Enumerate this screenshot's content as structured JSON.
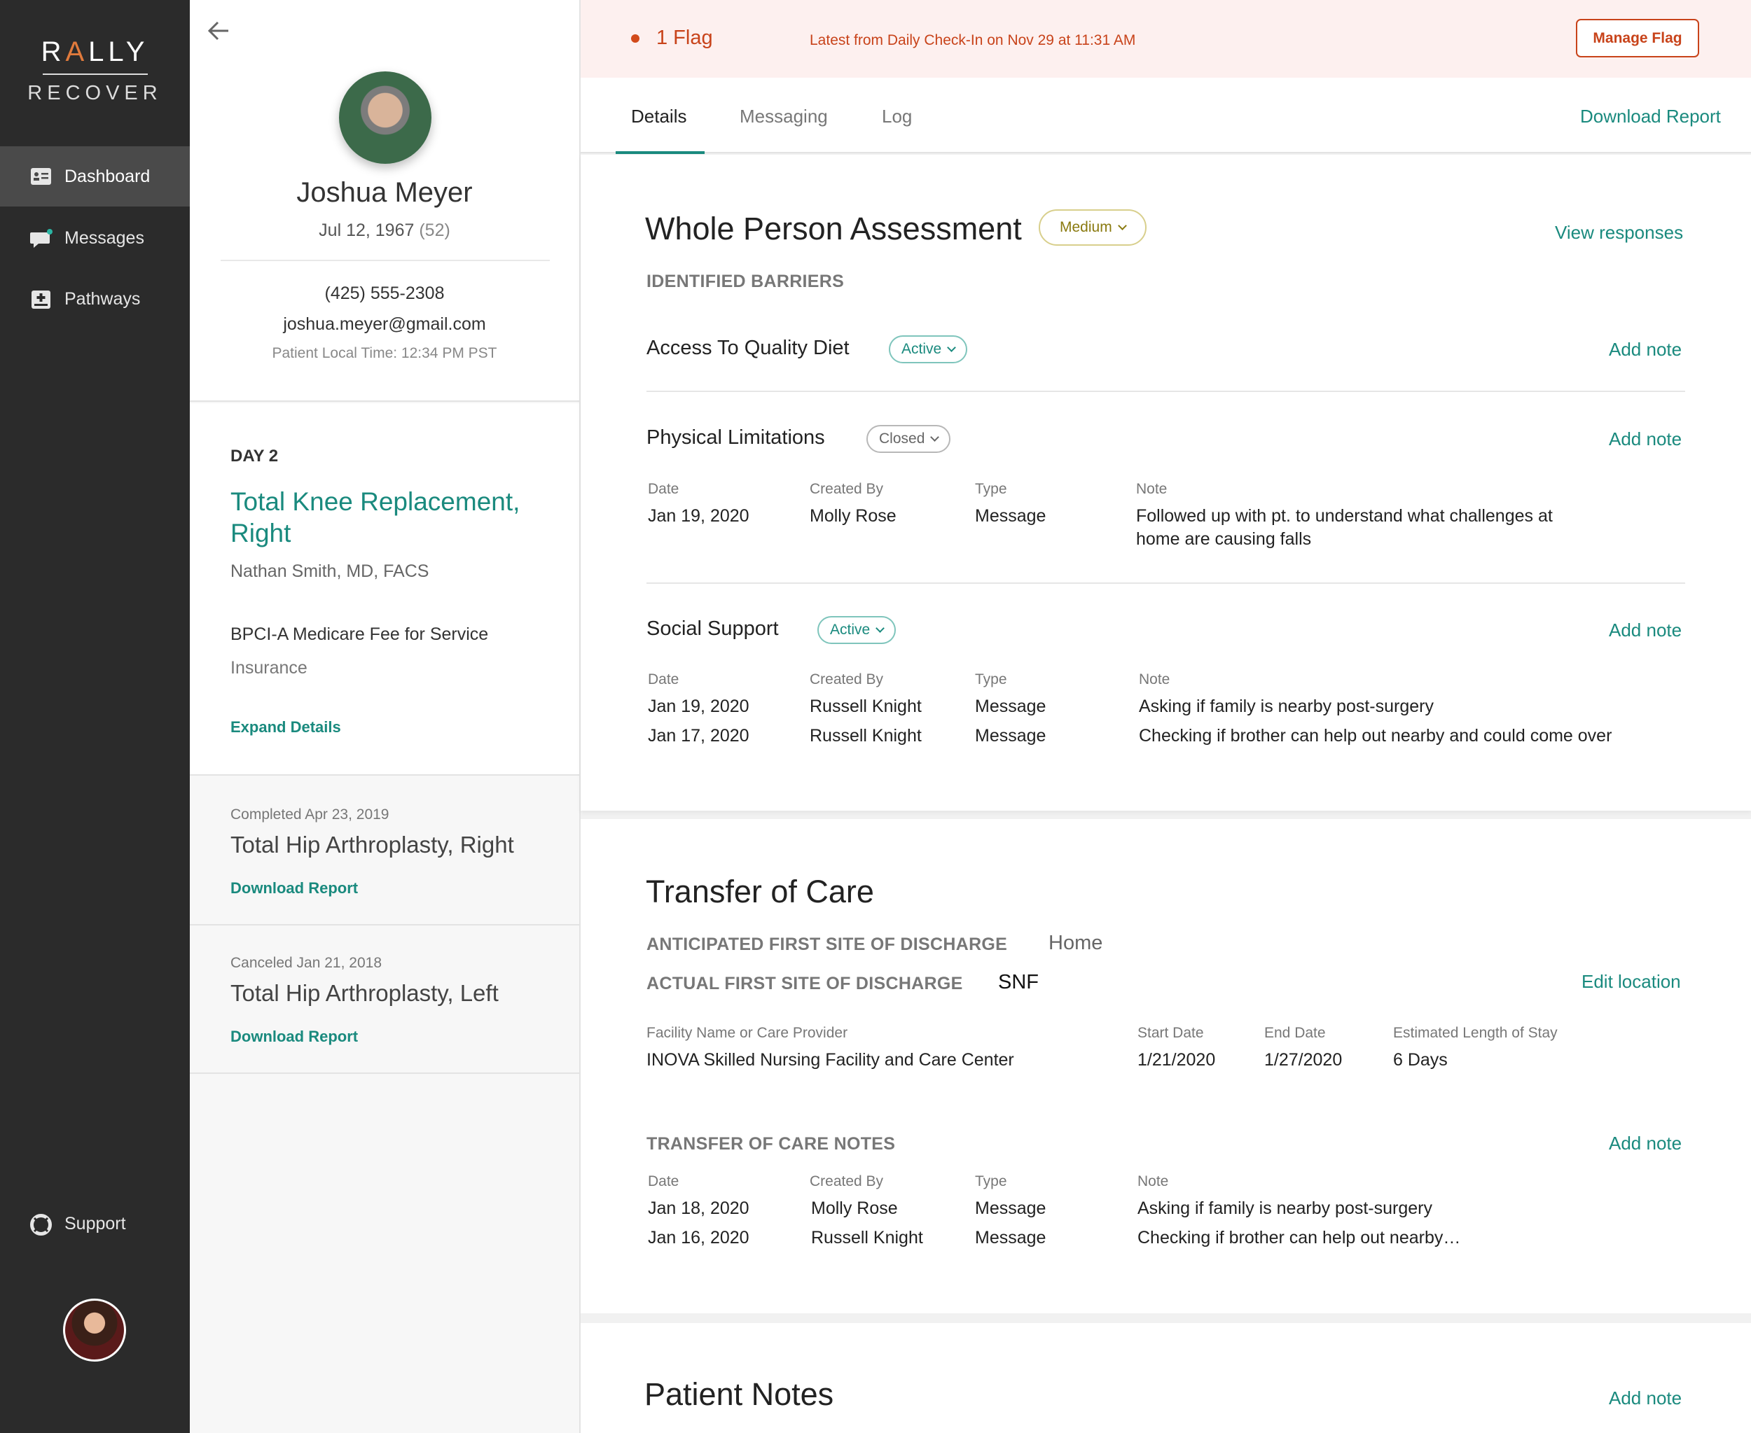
{
  "nav": {
    "brand_top": "RALLY",
    "brand_bottom": "RECOVER",
    "items": [
      {
        "label": "Dashboard",
        "icon": "dashboard-icon"
      },
      {
        "label": "Messages",
        "icon": "messages-icon"
      },
      {
        "label": "Pathways",
        "icon": "pathways-icon"
      }
    ],
    "support": "Support"
  },
  "patient": {
    "name": "Joshua Meyer",
    "dob": "Jul 12, 1967",
    "age": "(52)",
    "phone": "(425) 555-2308",
    "email": "joshua.meyer@gmail.com",
    "local_time": "Patient Local Time: 12:34 PM PST"
  },
  "episode": {
    "day": "DAY 2",
    "title": "Total Knee Replacement, Right",
    "surgeon": "Nathan Smith, MD, FACS",
    "plan": "BPCI-A Medicare Fee for Service",
    "plan_label": "Insurance",
    "expand": "Expand Details"
  },
  "past_episodes": [
    {
      "status": "Completed Apr 23, 2019",
      "title": "Total Hip Arthroplasty, Right",
      "link": "Download Report"
    },
    {
      "status": "Canceled Jan 21, 2018",
      "title": "Total Hip Arthroplasty, Left",
      "link": "Download Report"
    }
  ],
  "flag": {
    "count": "1 Flag",
    "latest": "Latest from Daily Check-In on Nov 29 at 11:31 AM",
    "button": "Manage Flag",
    "color": "#c8431a"
  },
  "tabs": {
    "items": [
      "Details",
      "Messaging",
      "Log"
    ],
    "download": "Download Report"
  },
  "wpa": {
    "title": "Whole Person Assessment",
    "risk": "Medium",
    "view": "View responses",
    "barriers_label": "IDENTIFIED BARRIERS",
    "add_note": "Add note",
    "columns": [
      "Date",
      "Created By",
      "Type",
      "Note"
    ],
    "barriers": [
      {
        "title": "Access To Quality Diet",
        "status": "Active",
        "rows": []
      },
      {
        "title": "Physical Limitations",
        "status": "Closed",
        "rows": [
          [
            "Jan 19, 2020",
            "Molly Rose",
            "Message",
            "Followed up with pt. to understand what challenges at home are causing falls"
          ]
        ]
      },
      {
        "title": "Social Support",
        "status": "Active",
        "rows": [
          [
            "Jan 19, 2020",
            "Russell Knight",
            "Message",
            "Asking if family is nearby post-surgery"
          ],
          [
            "Jan 17, 2020",
            "Russell Knight",
            "Message",
            "Checking if brother can help out nearby and could come over"
          ]
        ]
      }
    ]
  },
  "toc": {
    "title": "Transfer of Care",
    "anticipated_label": "ANTICIPATED FIRST SITE OF DISCHARGE",
    "anticipated_value": "Home",
    "actual_label": "ACTUAL FIRST SITE OF DISCHARGE",
    "actual_value": "SNF",
    "edit": "Edit location",
    "facility_cols": [
      "Facility Name or Care Provider",
      "Start Date",
      "End Date",
      "Estimated Length of Stay"
    ],
    "facility_row": [
      "INOVA Skilled Nursing Facility and Care Center",
      "1/21/2020",
      "1/27/2020",
      "6 Days"
    ],
    "notes_label": "TRANSFER OF CARE NOTES",
    "add_note": "Add note",
    "note_cols": [
      "Date",
      "Created By",
      "Type",
      "Note"
    ],
    "note_rows": [
      [
        "Jan 18, 2020",
        "Molly Rose",
        "Message",
        "Asking if family is nearby post-surgery"
      ],
      [
        "Jan 16, 2020",
        "Russell Knight",
        "Message",
        "Checking if brother can help out nearby…"
      ]
    ]
  },
  "patient_notes": {
    "title": "Patient Notes",
    "add_note": "Add note"
  },
  "colors": {
    "accent": "#1a8a7e",
    "flag": "#c8431a",
    "nav_bg": "#2b2b2b"
  }
}
